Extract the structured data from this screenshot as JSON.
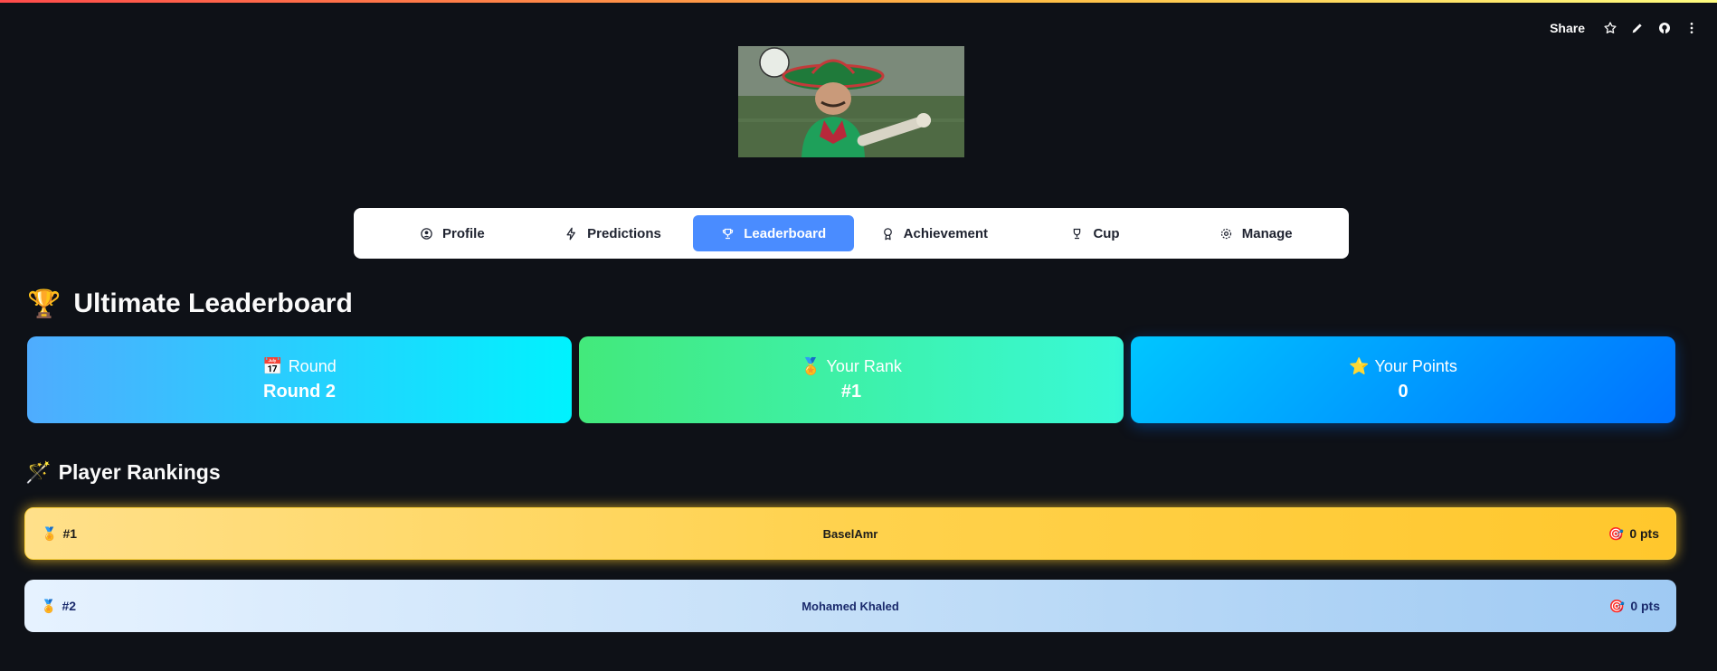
{
  "toolbar": {
    "share_label": "Share",
    "icons": [
      "star-icon",
      "edit-icon",
      "github-icon",
      "more-icon"
    ]
  },
  "hero": {
    "icon": "hero-image"
  },
  "nav": {
    "items": [
      {
        "label": "Profile",
        "icon": "user-circle-icon",
        "active": false
      },
      {
        "label": "Predictions",
        "icon": "lightning-icon",
        "active": false
      },
      {
        "label": "Leaderboard",
        "icon": "trophy-icon",
        "active": true
      },
      {
        "label": "Achievement",
        "icon": "award-icon",
        "active": false
      },
      {
        "label": "Cup",
        "icon": "cup-icon",
        "active": false
      },
      {
        "label": "Manage",
        "icon": "gear-icon",
        "active": false
      }
    ],
    "active_color": "#4a8cff"
  },
  "heading": {
    "emoji": "🏆",
    "title": "Ultimate Leaderboard"
  },
  "cards": {
    "round": {
      "emoji": "📅",
      "label": "Round",
      "value": "Round 2"
    },
    "rank": {
      "emoji": "🏅",
      "label": "Your Rank",
      "value": "#1"
    },
    "points": {
      "emoji": "⭐",
      "label": "Your Points",
      "value": "0"
    }
  },
  "rankings": {
    "emoji": "🪄",
    "title": "Player Rankings",
    "rows": [
      {
        "medal": "🏅",
        "rank": "#1",
        "name": "BaselAmr",
        "points_icon": "🎯",
        "points": "0 pts"
      },
      {
        "medal": "🏅",
        "rank": "#2",
        "name": "Mohamed Khaled",
        "points_icon": "🎯",
        "points": "0 pts"
      }
    ]
  }
}
